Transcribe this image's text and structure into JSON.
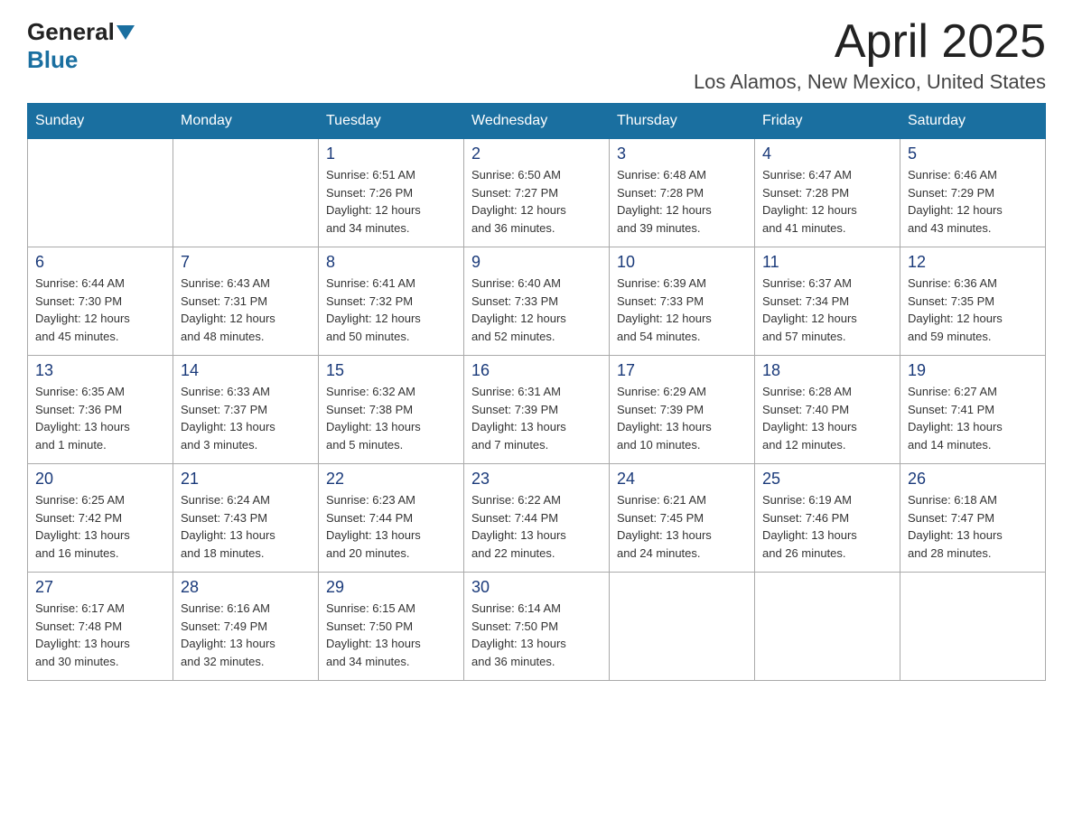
{
  "header": {
    "logo_general": "General",
    "logo_blue": "Blue",
    "month_year": "April 2025",
    "location": "Los Alamos, New Mexico, United States"
  },
  "days_of_week": [
    "Sunday",
    "Monday",
    "Tuesday",
    "Wednesday",
    "Thursday",
    "Friday",
    "Saturday"
  ],
  "weeks": [
    [
      {
        "day": "",
        "info": ""
      },
      {
        "day": "",
        "info": ""
      },
      {
        "day": "1",
        "info": "Sunrise: 6:51 AM\nSunset: 7:26 PM\nDaylight: 12 hours\nand 34 minutes."
      },
      {
        "day": "2",
        "info": "Sunrise: 6:50 AM\nSunset: 7:27 PM\nDaylight: 12 hours\nand 36 minutes."
      },
      {
        "day": "3",
        "info": "Sunrise: 6:48 AM\nSunset: 7:28 PM\nDaylight: 12 hours\nand 39 minutes."
      },
      {
        "day": "4",
        "info": "Sunrise: 6:47 AM\nSunset: 7:28 PM\nDaylight: 12 hours\nand 41 minutes."
      },
      {
        "day": "5",
        "info": "Sunrise: 6:46 AM\nSunset: 7:29 PM\nDaylight: 12 hours\nand 43 minutes."
      }
    ],
    [
      {
        "day": "6",
        "info": "Sunrise: 6:44 AM\nSunset: 7:30 PM\nDaylight: 12 hours\nand 45 minutes."
      },
      {
        "day": "7",
        "info": "Sunrise: 6:43 AM\nSunset: 7:31 PM\nDaylight: 12 hours\nand 48 minutes."
      },
      {
        "day": "8",
        "info": "Sunrise: 6:41 AM\nSunset: 7:32 PM\nDaylight: 12 hours\nand 50 minutes."
      },
      {
        "day": "9",
        "info": "Sunrise: 6:40 AM\nSunset: 7:33 PM\nDaylight: 12 hours\nand 52 minutes."
      },
      {
        "day": "10",
        "info": "Sunrise: 6:39 AM\nSunset: 7:33 PM\nDaylight: 12 hours\nand 54 minutes."
      },
      {
        "day": "11",
        "info": "Sunrise: 6:37 AM\nSunset: 7:34 PM\nDaylight: 12 hours\nand 57 minutes."
      },
      {
        "day": "12",
        "info": "Sunrise: 6:36 AM\nSunset: 7:35 PM\nDaylight: 12 hours\nand 59 minutes."
      }
    ],
    [
      {
        "day": "13",
        "info": "Sunrise: 6:35 AM\nSunset: 7:36 PM\nDaylight: 13 hours\nand 1 minute."
      },
      {
        "day": "14",
        "info": "Sunrise: 6:33 AM\nSunset: 7:37 PM\nDaylight: 13 hours\nand 3 minutes."
      },
      {
        "day": "15",
        "info": "Sunrise: 6:32 AM\nSunset: 7:38 PM\nDaylight: 13 hours\nand 5 minutes."
      },
      {
        "day": "16",
        "info": "Sunrise: 6:31 AM\nSunset: 7:39 PM\nDaylight: 13 hours\nand 7 minutes."
      },
      {
        "day": "17",
        "info": "Sunrise: 6:29 AM\nSunset: 7:39 PM\nDaylight: 13 hours\nand 10 minutes."
      },
      {
        "day": "18",
        "info": "Sunrise: 6:28 AM\nSunset: 7:40 PM\nDaylight: 13 hours\nand 12 minutes."
      },
      {
        "day": "19",
        "info": "Sunrise: 6:27 AM\nSunset: 7:41 PM\nDaylight: 13 hours\nand 14 minutes."
      }
    ],
    [
      {
        "day": "20",
        "info": "Sunrise: 6:25 AM\nSunset: 7:42 PM\nDaylight: 13 hours\nand 16 minutes."
      },
      {
        "day": "21",
        "info": "Sunrise: 6:24 AM\nSunset: 7:43 PM\nDaylight: 13 hours\nand 18 minutes."
      },
      {
        "day": "22",
        "info": "Sunrise: 6:23 AM\nSunset: 7:44 PM\nDaylight: 13 hours\nand 20 minutes."
      },
      {
        "day": "23",
        "info": "Sunrise: 6:22 AM\nSunset: 7:44 PM\nDaylight: 13 hours\nand 22 minutes."
      },
      {
        "day": "24",
        "info": "Sunrise: 6:21 AM\nSunset: 7:45 PM\nDaylight: 13 hours\nand 24 minutes."
      },
      {
        "day": "25",
        "info": "Sunrise: 6:19 AM\nSunset: 7:46 PM\nDaylight: 13 hours\nand 26 minutes."
      },
      {
        "day": "26",
        "info": "Sunrise: 6:18 AM\nSunset: 7:47 PM\nDaylight: 13 hours\nand 28 minutes."
      }
    ],
    [
      {
        "day": "27",
        "info": "Sunrise: 6:17 AM\nSunset: 7:48 PM\nDaylight: 13 hours\nand 30 minutes."
      },
      {
        "day": "28",
        "info": "Sunrise: 6:16 AM\nSunset: 7:49 PM\nDaylight: 13 hours\nand 32 minutes."
      },
      {
        "day": "29",
        "info": "Sunrise: 6:15 AM\nSunset: 7:50 PM\nDaylight: 13 hours\nand 34 minutes."
      },
      {
        "day": "30",
        "info": "Sunrise: 6:14 AM\nSunset: 7:50 PM\nDaylight: 13 hours\nand 36 minutes."
      },
      {
        "day": "",
        "info": ""
      },
      {
        "day": "",
        "info": ""
      },
      {
        "day": "",
        "info": ""
      }
    ]
  ]
}
